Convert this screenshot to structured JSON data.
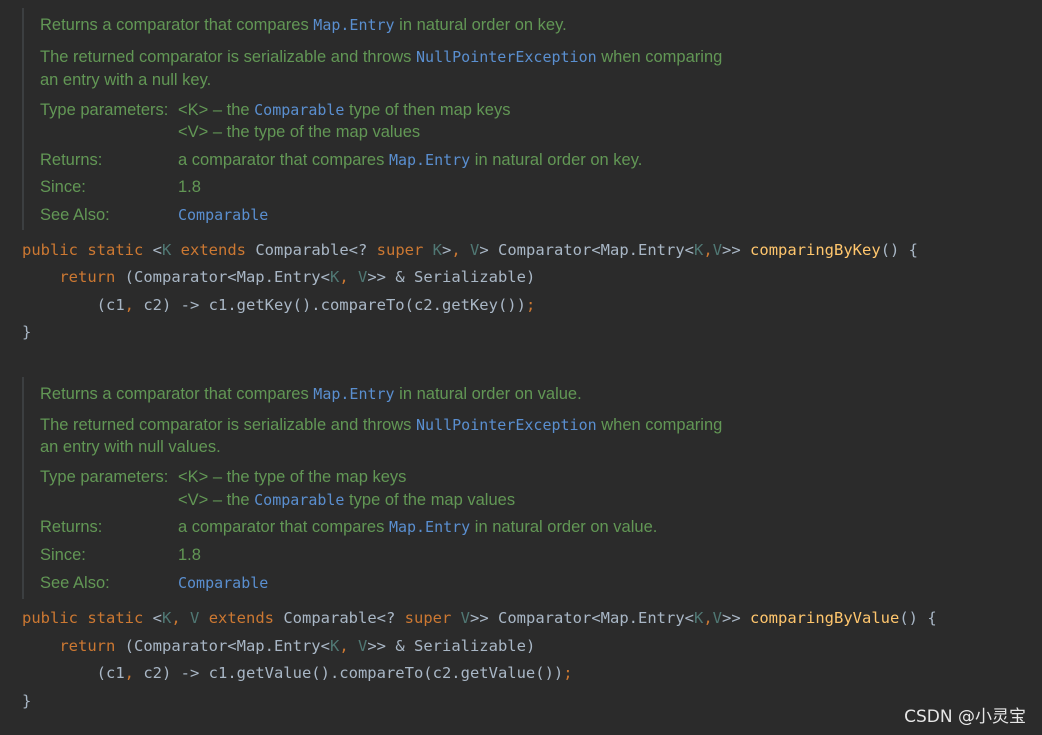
{
  "colors": {
    "background": "#2b2b2b",
    "doc_text": "#629755",
    "doc_link": "#5a8fd0",
    "keyword": "#cc7832",
    "type_param": "#507874",
    "method": "#ffc66d",
    "plain": "#a9b7c6"
  },
  "doc1": {
    "l1_pre": "Returns a comparator that compares ",
    "l1_link": "Map.Entry",
    "l1_post": " in natural order on key.",
    "l2_pre": "The returned comparator is serializable and throws ",
    "l2_link": "NullPointerException",
    "l2_post": " when comparing",
    "l3": "an entry with a null key.",
    "type_params_label": "Type parameters:",
    "tp1_a": "<K> – the ",
    "tp1_link": "Comparable",
    "tp1_b": " type of then map keys",
    "tp2": "<V> – the type of the map values",
    "returns_label": "Returns:",
    "returns_pre": "a comparator that compares ",
    "returns_link": "Map.Entry",
    "returns_post": " in natural order on key.",
    "since_label": "Since:",
    "since_value": "1.8",
    "see_label": "See Also:",
    "see_link": "Comparable"
  },
  "code1": {
    "l1_kw1": "public static",
    "l1_lt": " <",
    "l1_K": "K",
    "l1_ext": " extends",
    "l1_comp": " Comparable<? ",
    "l1_super": "super",
    "l1_K2": " K",
    "l1_gt": ">",
    "l1_comma": ",",
    "l1_V": " V",
    "l1_ret": "> Comparator<Map.Entry<",
    "l1_K3": "K",
    "l1_c2": ",",
    "l1_V2": "V",
    "l1_close": ">> ",
    "l1_fn": "comparingByKey",
    "l1_end": "() {",
    "l2_kw": "return",
    "l2_a": " (Comparator<Map.Entry<",
    "l2_K": "K",
    "l2_c": ",",
    "l2_V": " V",
    "l2_b": ">> & Serializable)",
    "l3_a": "(c1",
    "l3_c": ",",
    "l3_b": " c2) -> c1.getKey().compareTo(c2.getKey())",
    "l3_semi": ";",
    "l4": "}"
  },
  "doc2": {
    "l1_pre": "Returns a comparator that compares ",
    "l1_link": "Map.Entry",
    "l1_post": " in natural order on value.",
    "l2_pre": "The returned comparator is serializable and throws ",
    "l2_link": "NullPointerException",
    "l2_post": " when comparing",
    "l3": "an entry with null values.",
    "type_params_label": "Type parameters:",
    "tp1": "<K> – the type of the map keys",
    "tp2_a": "<V> – the ",
    "tp2_link": "Comparable",
    "tp2_b": " type of the map values",
    "returns_label": "Returns:",
    "returns_pre": "a comparator that compares ",
    "returns_link": "Map.Entry",
    "returns_post": " in natural order on value.",
    "since_label": "Since:",
    "since_value": "1.8",
    "see_label": "See Also:",
    "see_link": "Comparable"
  },
  "code2": {
    "l1_kw1": "public static",
    "l1_lt": " <",
    "l1_K": "K",
    "l1_comma": ",",
    "l1_V": " V",
    "l1_ext": " extends",
    "l1_comp": " Comparable<? ",
    "l1_super": "super",
    "l1_V2": " V",
    "l1_ret": ">> Comparator<Map.Entry<",
    "l1_K3": "K",
    "l1_c2": ",",
    "l1_V3": "V",
    "l1_close": ">> ",
    "l1_fn": "comparingByValue",
    "l1_end": "() {",
    "l2_kw": "return",
    "l2_a": " (Comparator<Map.Entry<",
    "l2_K": "K",
    "l2_c": ",",
    "l2_V": " V",
    "l2_b": ">> & Serializable)",
    "l3_a": "(c1",
    "l3_c": ",",
    "l3_b": " c2) -> c1.getValue().compareTo(c2.getValue())",
    "l3_semi": ";",
    "l4": "}"
  },
  "watermark": "CSDN @小灵宝"
}
